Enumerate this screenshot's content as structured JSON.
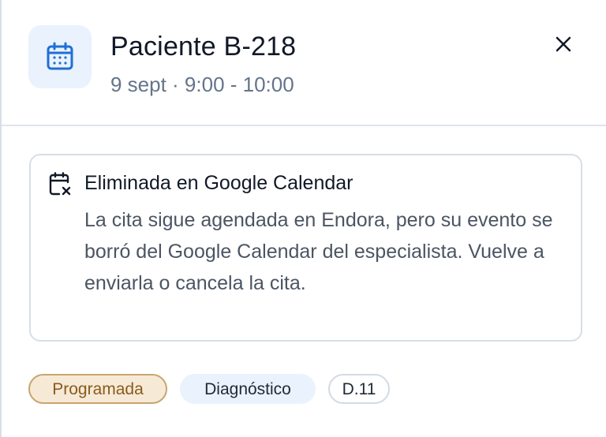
{
  "header": {
    "title": "Paciente B-218",
    "subtitle": "9 sept · 9:00 - 10:00",
    "icon": "calendar-icon",
    "close_icon": "close-icon"
  },
  "alert": {
    "icon": "calendar-x-icon",
    "title": "Eliminada en Google Calendar",
    "body": "La cita sigue agendada en Endora, pero su evento se borró del Google Calendar del especialista. Vuelve a enviarla o cancela la cita."
  },
  "badges": [
    {
      "label": "Programada",
      "color": "#f6ead7"
    },
    {
      "label": "Diagnóstico",
      "color": "#eaf2fd"
    },
    {
      "label": "D.11",
      "color": "#ffffff"
    }
  ],
  "colors": {
    "accent": "#1f6fd6",
    "status_bg": "#f6ead7",
    "status_border": "#c9a46e"
  }
}
